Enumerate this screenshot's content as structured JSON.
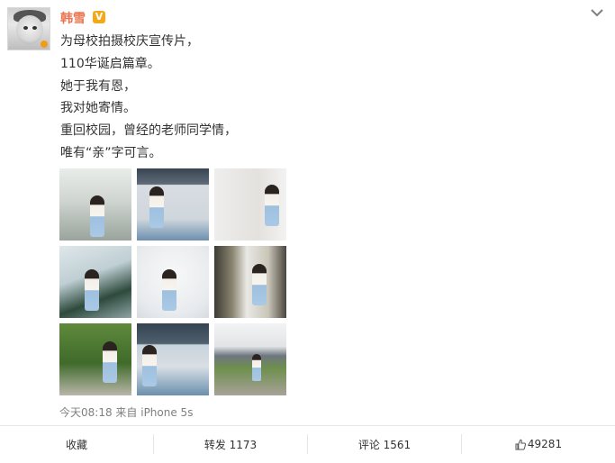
{
  "user": {
    "name": "韩雪",
    "verified_mark": "V"
  },
  "post": {
    "lines": [
      "为母校拍摄校庆宣传片，",
      "110华诞启篇章。",
      "她于我有恩，",
      "我对她寄情。",
      "重回校园，曾经的老师同学情，",
      "唯有“亲”字可言。"
    ],
    "timestamp": "今天08:18",
    "source": "来自 iPhone 5s"
  },
  "actions": {
    "favorite": "收藏",
    "repost": "转发 1173",
    "comment": "评论 1561",
    "like": "49281"
  },
  "icons": {
    "menu": "chevron-down-icon",
    "like": "thumbs-up-icon",
    "verified": "verified-badge-icon"
  },
  "colors": {
    "username": "#eb7350",
    "verified": "#f3a917",
    "meta": "#808080"
  }
}
